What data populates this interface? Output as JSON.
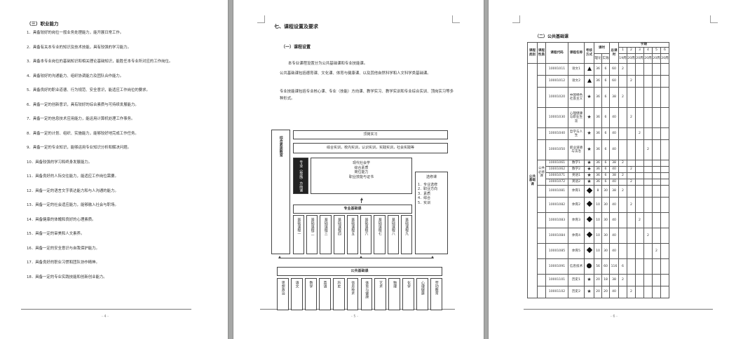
{
  "page1": {
    "heading": "（三）职业能力",
    "items": [
      "1．具备较好的岗位一般业务处理能力，能开展日常工作。",
      "2．具备有关本专业的知识及技术技能，具有较强的学习能力。",
      "3．具备本专业岗位的基础知识和相关理论基础知识，能胜任本专业所对应的工作岗位。",
      "4．具备较好的沟通能力、组织协调能力及团队合作能力。",
      "5．具备良好的职业道德、行为规范、安全意识，能适应工作岗位的要求。",
      "6．具备一定的创新意识，具有较好的综合素质与可持续发展能力。",
      "7．具备一定的信息技术应用能力，能运用计算机处理工作事务。",
      "8．具备一定的计划、组织、实施能力，能够较好地完成工作任务。",
      "9．具备一定的专业知识，能够运用专业知识分析和解决问题。",
      "10．具备较强的学习和终身发展能力。",
      "11．具备良好的人际交往能力，能适应工作岗位需要。",
      "12．具备一定的语言文字表达能力和与人沟通的能力。",
      "13．具备一定的社会适应能力，能够融入社会与职场。",
      "14．具备健康的体魄和良好的心理素质。",
      "15．具备一定的审美和人文素养。",
      "16．具备一定的安全意识与自我保护能力。",
      "17．具备良好的职业习惯和团队协作精神。",
      "18．具备一定的专业实践技能和创新创业能力。"
    ],
    "footer": "- 4 -"
  },
  "page2": {
    "heading": "七、课程设置及要求",
    "subheading": "（一）课程设置",
    "paragraphs": [
      "本专业课程设置分为公共基础课和专业技能课。",
      "公共基础课包括德育课、文化课、体育与健康课、以及其他自然科学和人文科学类基础课。",
      "专业技能课包括专业核心课、专业（技能）方向课、教学实习、教学实训和专业综合实训、顶岗实习等多种形式。"
    ],
    "diagram": {
      "left_label": "综合素质教育",
      "top_box": "顶岗实习",
      "practice_box": "综合实训，校内实训，认识实训，实践实训，社会实践等",
      "middle_label": "专业（技能）方向课",
      "middle_lines": [
        "现代社会学",
        "综合素质",
        "岗位能力",
        "职业技能与证书"
      ],
      "right_title": "选修课",
      "right_items": [
        "1．专业选修",
        "2．职业方向",
        "3．素质",
        "4．综合",
        "5．实训"
      ],
      "core_label": "专业基础课",
      "core_courses": [
        "基础课程一",
        "基础课程二",
        "基础课程三",
        "基础课程四",
        "基础课程五",
        "基础课程六",
        "基础课程七",
        "基础课程八",
        "基础课程九"
      ],
      "public_label": "公共基础课",
      "public_courses": [
        "思想政治",
        "语文",
        "数学",
        "英语",
        "历史",
        "信息技术",
        "体育与健康",
        "艺术",
        "物理",
        "化学",
        "心理健康",
        "劳动教育"
      ]
    },
    "footer": "- 5 -"
  },
  "page3": {
    "heading": "（二）公共基础课",
    "table": {
      "col_category": "课程类别",
      "col_nature": "课程性质",
      "col_code": "课程代码",
      "col_name": "课程名称",
      "col_mode": "考核方式",
      "col_hours": "课时",
      "col_theory": "理论",
      "col_practice": "实践",
      "col_total": "总课时",
      "col_semester": "学期",
      "semesters": [
        "1",
        "2",
        "3",
        "4",
        "5",
        "6"
      ],
      "weeks": [
        "19周",
        "20周",
        "20周",
        "20周",
        "20周",
        "20周"
      ],
      "category_label": "公共基础课",
      "nature_label": "公共必修课",
      "rows": [
        {
          "code": "10001011",
          "name": "语文1",
          "mode": "tri",
          "theory": "36",
          "practice": "6",
          "total": "60",
          "sem": [
            "2",
            "",
            "",
            "",
            "",
            ""
          ]
        },
        {
          "code": "10001012",
          "name": "语文2",
          "mode": "tri",
          "theory": "36",
          "practice": "6",
          "total": "60",
          "sem": [
            "",
            "2",
            "",
            "",
            "",
            ""
          ]
        },
        {
          "code": "10001020",
          "name": "中国特色社会主义",
          "mode": "star",
          "theory": "36",
          "practice": "6",
          "total": "38",
          "sem": [
            "2",
            "",
            "",
            "",
            "",
            ""
          ]
        },
        {
          "code": "10001030",
          "name": "心理健康与职业生涯",
          "mode": "star",
          "theory": "36",
          "practice": "6",
          "total": "40",
          "sem": [
            "",
            "2",
            "",
            "",
            "",
            ""
          ]
        },
        {
          "code": "10001040",
          "name": "哲学与人生",
          "mode": "star",
          "theory": "36",
          "practice": "6",
          "total": "40",
          "sem": [
            "",
            "",
            "2",
            "",
            "",
            ""
          ]
        },
        {
          "code": "10001050",
          "name": "职业道德与法治",
          "mode": "star",
          "theory": "36",
          "practice": "6",
          "total": "40",
          "sem": [
            "",
            "",
            "",
            "2",
            "",
            ""
          ]
        },
        {
          "code": "10001061",
          "name": "数学1",
          "mode": "star",
          "theory": "36",
          "practice": "6",
          "total": "38",
          "sem": [
            "2",
            "",
            "",
            "",
            "",
            ""
          ]
        },
        {
          "code": "10001062",
          "name": "数学2",
          "mode": "star",
          "theory": "36",
          "practice": "6",
          "total": "40",
          "sem": [
            "",
            "2",
            "",
            "",
            "",
            ""
          ]
        },
        {
          "code": "10001071",
          "name": "英语1",
          "mode": "star",
          "theory": "36",
          "practice": "6",
          "total": "38",
          "sem": [
            "2",
            "",
            "",
            "",
            "",
            ""
          ]
        },
        {
          "code": "10001072",
          "name": "英语2",
          "mode": "star",
          "theory": "36",
          "practice": "6",
          "total": "40",
          "sem": [
            "",
            "2",
            "",
            "",
            "",
            ""
          ]
        },
        {
          "code": "10001081",
          "name": "体育1",
          "mode": "dia",
          "theory": "8",
          "practice": "30",
          "total": "38",
          "sem": [
            "2",
            "",
            "",
            "",
            "",
            ""
          ]
        },
        {
          "code": "10001082",
          "name": "体育2",
          "mode": "dia",
          "theory": "10",
          "practice": "30",
          "total": "40",
          "sem": [
            "",
            "2",
            "",
            "",
            "",
            ""
          ]
        },
        {
          "code": "10001083",
          "name": "体育3",
          "mode": "dia",
          "theory": "10",
          "practice": "30",
          "total": "40",
          "sem": [
            "",
            "",
            "2",
            "",
            "",
            ""
          ]
        },
        {
          "code": "10001084",
          "name": "体育4",
          "mode": "dia",
          "theory": "10",
          "practice": "30",
          "total": "40",
          "sem": [
            "",
            "",
            "",
            "2",
            "",
            ""
          ]
        },
        {
          "code": "10001085",
          "name": "体育5",
          "mode": "dia",
          "theory": "10",
          "practice": "30",
          "total": "40",
          "sem": [
            "",
            "",
            "",
            "",
            "2",
            ""
          ]
        },
        {
          "code": "10001091",
          "name": "信息技术",
          "mode": "cir",
          "theory": "56",
          "practice": "60",
          "total": "116",
          "sem": [
            "6",
            "",
            "",
            "",
            "",
            ""
          ]
        },
        {
          "code": "10001101",
          "name": "历史1",
          "mode": "star",
          "theory": "20",
          "practice": "18",
          "total": "38",
          "sem": [
            "2",
            "",
            "",
            "",
            "",
            ""
          ]
        },
        {
          "code": "10001102",
          "name": "历史2",
          "mode": "star",
          "theory": "20",
          "practice": "20",
          "total": "40",
          "sem": [
            "",
            "2",
            "",
            "",
            "",
            ""
          ]
        }
      ]
    },
    "footer": "- 6 -"
  }
}
